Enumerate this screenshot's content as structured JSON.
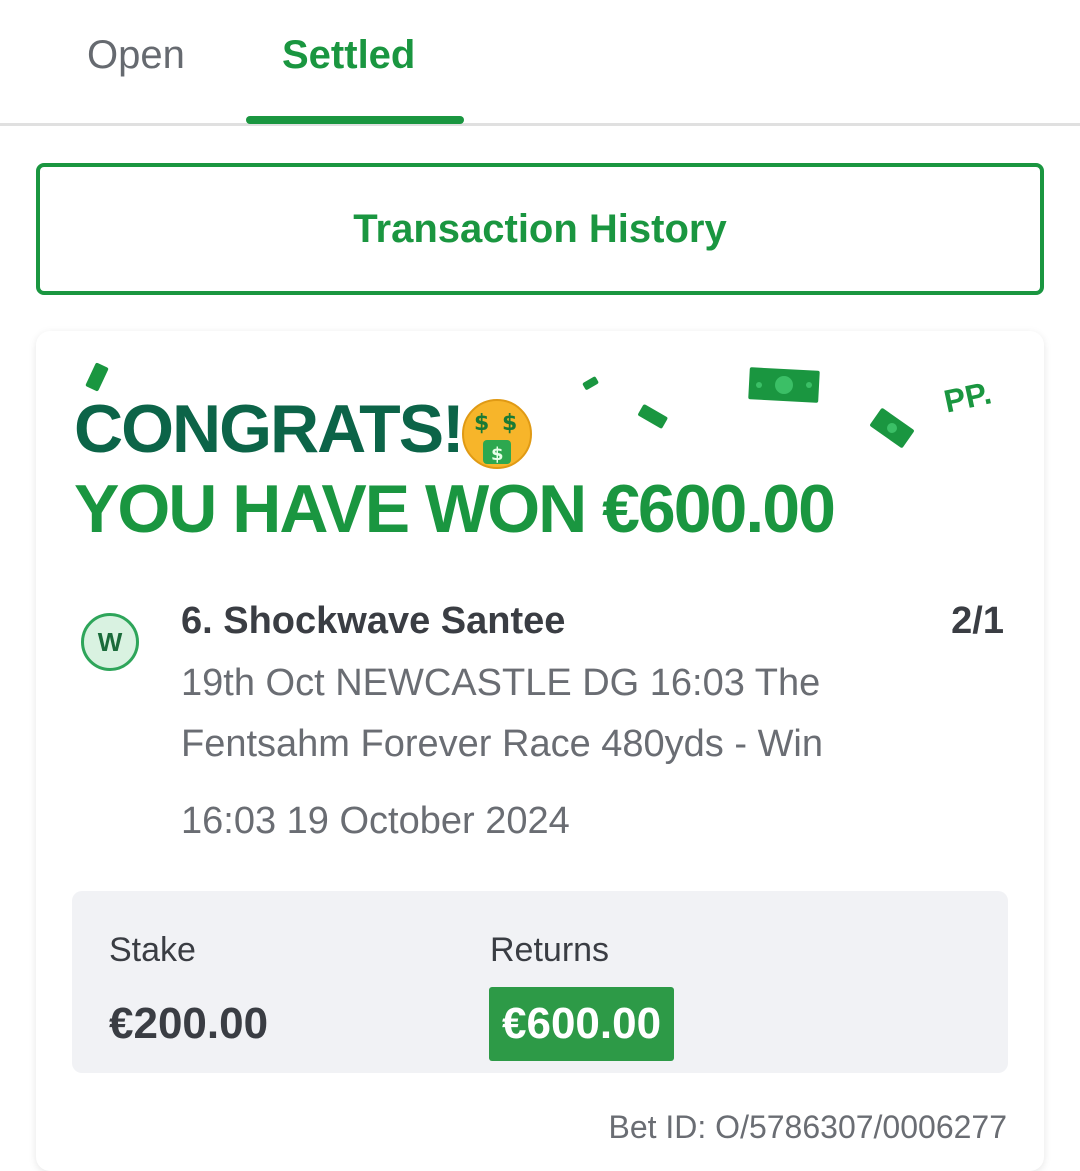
{
  "tabs": {
    "open": "Open",
    "settled": "Settled"
  },
  "transaction_history_label": "Transaction History",
  "banner": {
    "congrats": "CONGRATS!",
    "won_text": "YOU HAVE WON €600.00",
    "logo_text": "PP.",
    "emoji_icon": "money-mouth-face-icon"
  },
  "bet": {
    "result_badge": "W",
    "selection": "6. Shockwave Santee",
    "odds": "2/1",
    "event": "19th Oct NEWCASTLE DG 16:03 The Fentsahm Forever Race 480yds - Win",
    "datetime": "16:03 19 October 2024",
    "stake_label": "Stake",
    "stake_value": "€200.00",
    "returns_label": "Returns",
    "returns_value": "€600.00",
    "bet_id": "Bet ID: O/5786307/0006277"
  },
  "colors": {
    "brand_green": "#1a9640",
    "dark_green": "#0c6448",
    "returns_bg": "#2d9a47",
    "text_dark": "#3a3d43",
    "text_grey": "#6a6d73"
  }
}
